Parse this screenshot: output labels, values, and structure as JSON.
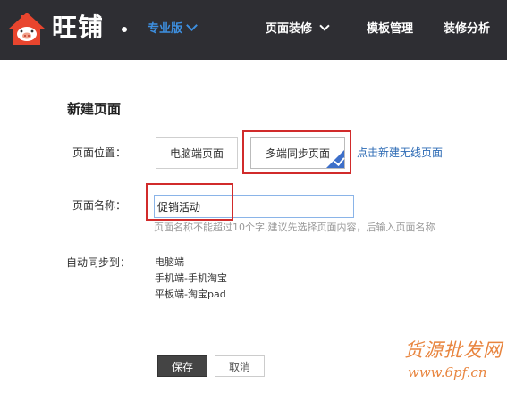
{
  "header": {
    "brand": "旺铺",
    "edition": "专业版",
    "nav": [
      {
        "label": "页面装修",
        "has_dropdown": true
      },
      {
        "label": "模板管理",
        "has_dropdown": false
      },
      {
        "label": "装修分析",
        "has_dropdown": false
      }
    ]
  },
  "form": {
    "title": "新建页面",
    "location_label": "页面位置：",
    "location_options": [
      "电脑端页面",
      "多端同步页面"
    ],
    "selected_location": "多端同步页面",
    "wireless_link": "点击新建无线页面",
    "name_label": "页面名称：",
    "name_value": "促销活动",
    "name_hint": "页面名称不能超过10个字,建议先选择页面内容，后输入页面名称",
    "sync_label": "自动同步到：",
    "sync_targets": [
      "电脑端",
      "手机端-手机淘宝",
      "平板端-淘宝pad"
    ],
    "save_label": "保存",
    "cancel_label": "取消"
  },
  "watermark": {
    "line1": "货源批发网",
    "line2": "www.6pf.cn"
  },
  "colors": {
    "topbar": "#2e2e33",
    "accent": "#3d8fe0",
    "highlight": "#d12b2b",
    "link": "#2d6bb5"
  }
}
